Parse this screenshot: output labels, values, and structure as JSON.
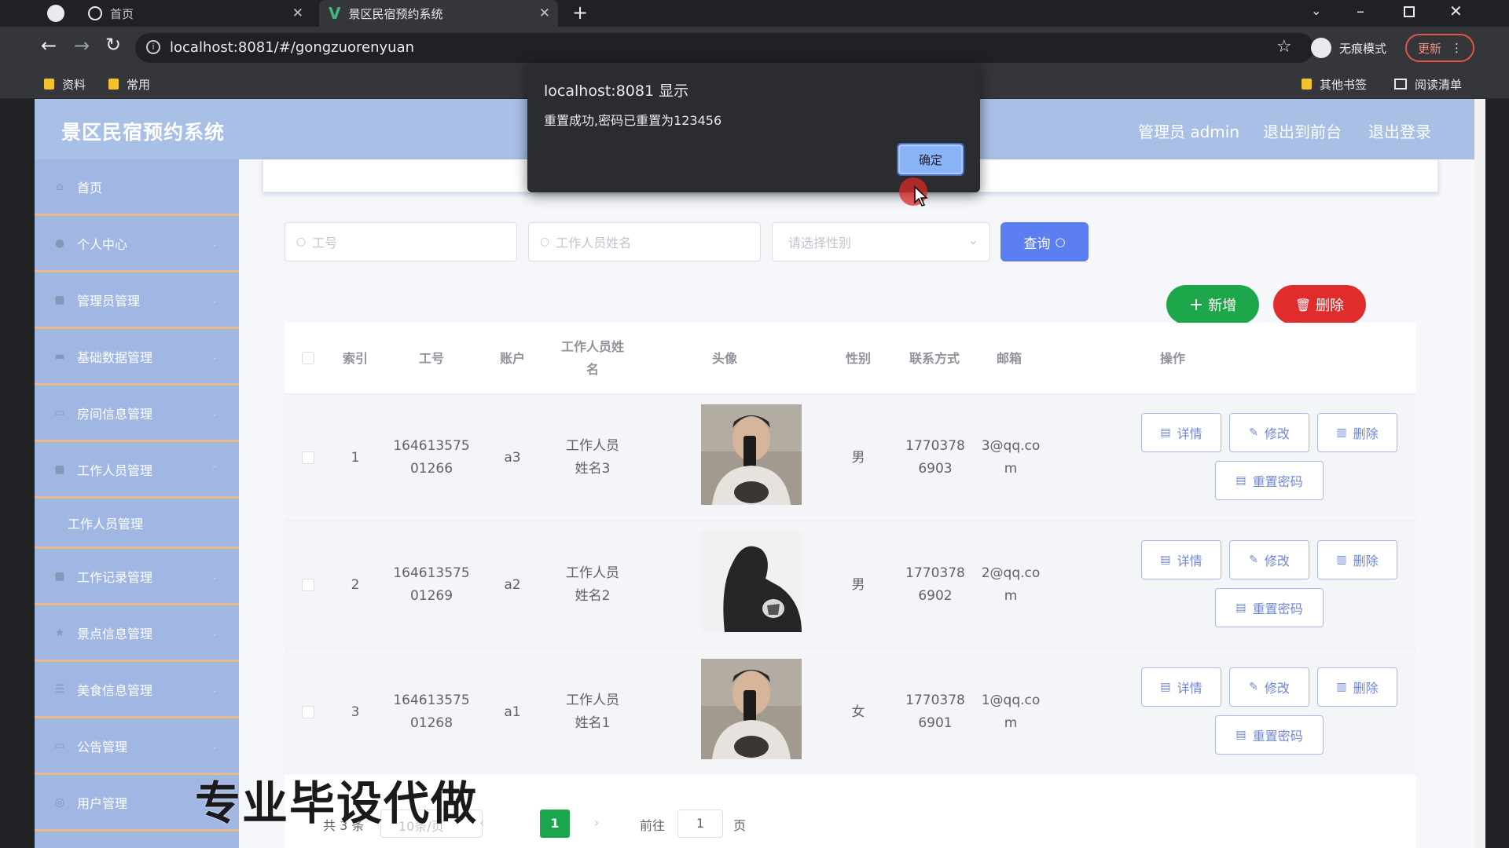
{
  "browser": {
    "tabs": [
      {
        "label": "首页"
      },
      {
        "label": "景区民宿预约系统"
      }
    ],
    "url": "localhost:8081/#/gongzuorenyuan",
    "incognito_label": "无痕模式",
    "update_label": "更新",
    "bookmarks": [
      "资料",
      "常用"
    ],
    "bookmarks_right": [
      "其他书签",
      "阅读清单"
    ]
  },
  "header": {
    "title": "景区民宿预约系统",
    "admin_label": "管理员 admin",
    "front_label": "退出到前台",
    "logout_label": "退出登录"
  },
  "sidebar": {
    "items": [
      {
        "label": "首页",
        "icon": "home-icon"
      },
      {
        "label": "个人中心",
        "icon": "user-icon"
      },
      {
        "label": "管理员管理",
        "icon": "admin-icon"
      },
      {
        "label": "基础数据管理",
        "icon": "data-icon"
      },
      {
        "label": "房间信息管理",
        "icon": "room-icon"
      },
      {
        "label": "工作人员管理",
        "icon": "staff-icon"
      },
      {
        "label": "工作记录管理",
        "icon": "record-icon"
      },
      {
        "label": "景点信息管理",
        "icon": "scenic-icon"
      },
      {
        "label": "美食信息管理",
        "icon": "food-icon"
      },
      {
        "label": "公告管理",
        "icon": "notice-icon"
      },
      {
        "label": "用户管理",
        "icon": "users-icon"
      }
    ],
    "sub_item": "工作人员管理"
  },
  "search": {
    "id_placeholder": "工号",
    "name_placeholder": "工作人员姓名",
    "gender_placeholder": "请选择性别",
    "query_label": "查询"
  },
  "actions": {
    "add_label": "新增",
    "delete_label": "删除"
  },
  "table": {
    "headers": [
      "索引",
      "工号",
      "账户",
      "工作人员姓名",
      "头像",
      "性别",
      "联系方式",
      "邮箱",
      "操作"
    ],
    "rows": [
      {
        "index": "1",
        "id": "16461357501266",
        "account": "a3",
        "name": "工作人员姓名3",
        "gender": "男",
        "phone": "17703786903",
        "email": "3@qq.com"
      },
      {
        "index": "2",
        "id": "16461357501269",
        "account": "a2",
        "name": "工作人员姓名2",
        "gender": "男",
        "phone": "17703786902",
        "email": "2@qq.com"
      },
      {
        "index": "3",
        "id": "16461357501268",
        "account": "a1",
        "name": "工作人员姓名1",
        "gender": "女",
        "phone": "17703786901",
        "email": "1@qq.com"
      }
    ],
    "row_buttons": {
      "detail": "详情",
      "edit": "修改",
      "delete": "删除",
      "reset": "重置密码"
    }
  },
  "pager": {
    "total": "共 3 条",
    "page_size": "10条/页",
    "current": "1",
    "goto_label": "前往",
    "goto_value": "1",
    "page_suffix": "页"
  },
  "dialog": {
    "title": "localhost:8081 显示",
    "message": "重置成功,密码已重置为123456",
    "ok_label": "确定"
  },
  "watermark": "专业毕设代做",
  "colors": {
    "header": "#a8bfe6",
    "sidebar": "#a0b6e3",
    "query": "#5b7ff0",
    "add": "#1ea64a",
    "delete": "#e02c2c",
    "pager_active": "#1aa64c"
  }
}
